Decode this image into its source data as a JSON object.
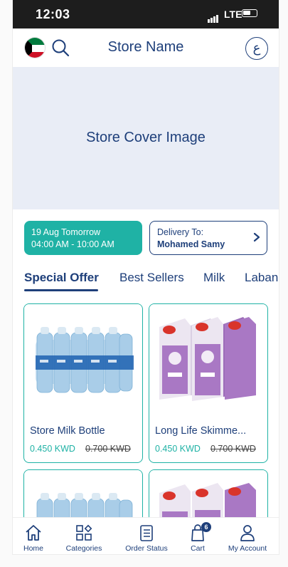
{
  "status_bar": {
    "time": "12:03",
    "network": "LTE"
  },
  "header": {
    "title": "Store Name",
    "language_button": "ع"
  },
  "cover": {
    "text": "Store Cover Image"
  },
  "delivery": {
    "slot_date": "19 Aug Tomorrow",
    "slot_time": "04:00 AM - 10:00 AM",
    "delivery_to_label": "Delivery To:",
    "delivery_to_name": "Mohamed Samy"
  },
  "tabs": [
    {
      "label": "Special Offer",
      "active": true
    },
    {
      "label": "Best Sellers",
      "active": false
    },
    {
      "label": "Milk",
      "active": false
    },
    {
      "label": "Laban",
      "active": false
    }
  ],
  "products": [
    {
      "name": "Store Milk Bottle",
      "price": "0.450 KWD",
      "old_price": "0.700 KWD",
      "image": "water-bottles"
    },
    {
      "name": "Long Life Skimme...",
      "price": "0.450 KWD",
      "old_price": "0.700 KWD",
      "image": "milk-cartons"
    },
    {
      "name": "",
      "price": "",
      "old_price": "",
      "image": "water-bottles"
    },
    {
      "name": "",
      "price": "",
      "old_price": "",
      "image": "milk-cartons"
    }
  ],
  "bottom_nav": [
    {
      "label": "Home",
      "icon": "home-icon"
    },
    {
      "label": "Categories",
      "icon": "categories-icon"
    },
    {
      "label": "Order Status",
      "icon": "order-status-icon"
    },
    {
      "label": "Cart",
      "icon": "cart-icon",
      "badge": "6"
    },
    {
      "label": "My Account",
      "icon": "account-icon"
    }
  ],
  "colors": {
    "primary": "#1e3f7a",
    "accent": "#1fb2a5",
    "cover_bg": "#e9edf6"
  }
}
